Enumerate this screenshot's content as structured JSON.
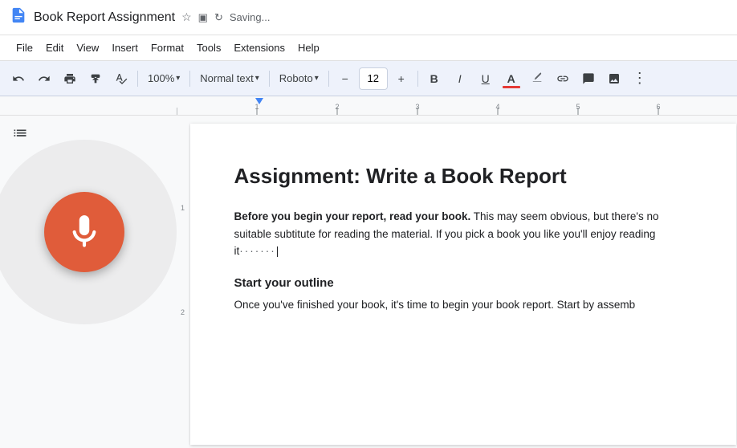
{
  "titleBar": {
    "docIcon": "📄",
    "title": "Book Report Assignment",
    "starIcon": "☆",
    "driveIcon": "▣",
    "savingText": "Saving..."
  },
  "menuBar": {
    "items": [
      "File",
      "Edit",
      "View",
      "Insert",
      "Format",
      "Tools",
      "Extensions",
      "Help"
    ]
  },
  "toolbar": {
    "undoLabel": "↺",
    "redoLabel": "↻",
    "printLabel": "🖨",
    "paintLabel": "✎",
    "spellLabel": "T",
    "zoom": "100%",
    "zoomArrow": "▾",
    "textStyle": "Normal text",
    "textStyleArrow": "▾",
    "font": "Roboto",
    "fontArrow": "▾",
    "fontSizeMinus": "−",
    "fontSize": "12",
    "fontSizePlus": "+",
    "bold": "B",
    "italic": "I",
    "underline": "U",
    "textColor": "A",
    "highlight": "✏",
    "link": "🔗",
    "comment": "💬",
    "image": "🖼",
    "more": "⋮"
  },
  "document": {
    "heading": "Assignment: Write a Book Report",
    "para1Bold": "Before you begin your report, read your book.",
    "para1Rest": " This may seem obvious, but there's no suitable subtitute for reading the material. If you pick a book you like you'll enjoy reading it",
    "para1Dots": "·······|",
    "section1Title": "Start your outline",
    "section1Body": "Once you've finished your book, it's time to begin your book report. Start by assemb"
  },
  "voice": {
    "label": "Voice typing"
  }
}
